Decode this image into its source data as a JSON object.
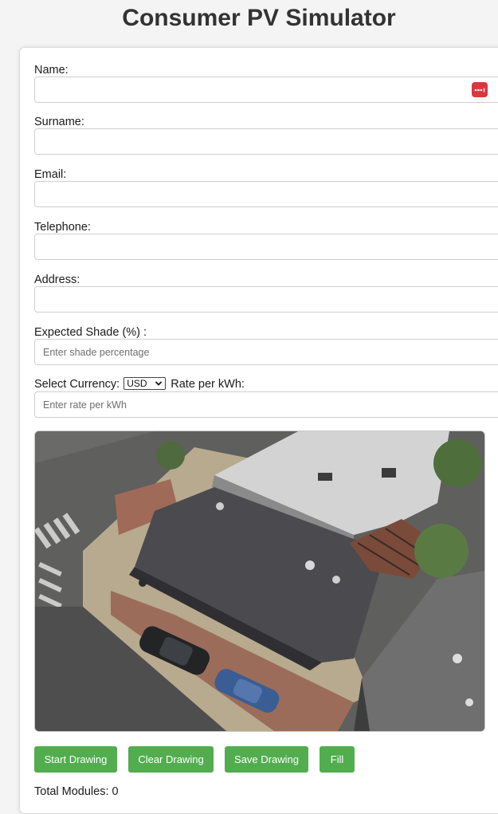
{
  "page": {
    "title": "Consumer PV Simulator"
  },
  "form": {
    "name_label": "Name:",
    "name_value": "",
    "surname_label": "Surname:",
    "surname_value": "",
    "email_label": "Email:",
    "email_value": "",
    "telephone_label": "Telephone:",
    "telephone_value": "",
    "address_label": "Address:",
    "address_value": "",
    "shade_label": "Expected Shade (%) :",
    "shade_placeholder": "Enter shade percentage",
    "currency_label": "Select Currency:",
    "currency_selected": "USD",
    "rate_label": "Rate per kWh:",
    "rate_placeholder": "Enter rate per kWh"
  },
  "icons": {
    "password_manager": "password-manager-icon",
    "dropdown": "chevron-down-icon"
  },
  "map": {
    "content": "aerial-satellite-view"
  },
  "toolbar": {
    "start_label": "Start Drawing",
    "clear_label": "Clear Drawing",
    "save_label": "Save Drawing",
    "fill_label": "Fill"
  },
  "summary": {
    "total_modules_label": "Total Modules:",
    "total_modules_value": "0"
  },
  "colors": {
    "button_green": "#52ad4f",
    "title_text": "#333333",
    "password_icon_red": "#d9363e",
    "page_background": "#f4f4f4"
  }
}
